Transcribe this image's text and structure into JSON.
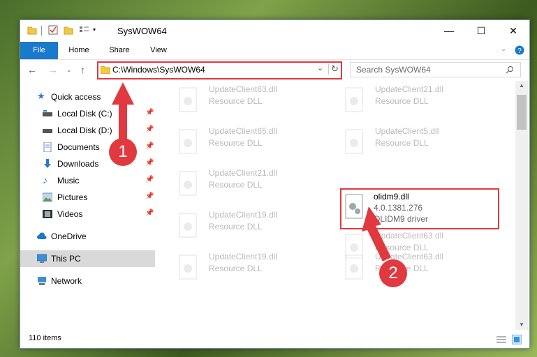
{
  "window": {
    "title": "SysWOW64"
  },
  "ribbon": {
    "tabs": [
      "File",
      "Home",
      "Share",
      "View"
    ]
  },
  "address": {
    "path": "C:\\Windows\\SysWOW64"
  },
  "search": {
    "placeholder": "Search SysWOW64"
  },
  "sidebar": {
    "items": [
      {
        "label": "Quick access"
      },
      {
        "label": "Local Disk (C:)"
      },
      {
        "label": "Local Disk (D:)"
      },
      {
        "label": "Documents"
      },
      {
        "label": "Downloads"
      },
      {
        "label": "Music"
      },
      {
        "label": "Pictures"
      },
      {
        "label": "Videos"
      },
      {
        "label": "OneDrive"
      },
      {
        "label": "This PC"
      },
      {
        "label": "Network"
      }
    ]
  },
  "files": [
    {
      "name": "UpdateClient63.dll",
      "desc": "Resource DLL"
    },
    {
      "name": "UpdateClient21.dll",
      "desc": "Resource DLL"
    },
    {
      "name": "UpdateClient65.dll",
      "desc": "Resource DLL"
    },
    {
      "name": "UpdateClient5.dll",
      "desc": "Resource DLL"
    },
    {
      "name": "UpdateClient21.dll",
      "desc": "Resource DLL"
    },
    {
      "name": "olidm9.dll",
      "version": "4.0.1381.276",
      "desc": "OLIDM9 driver"
    },
    {
      "name": "UpdateClient19.dll",
      "desc": "Resource DLL"
    },
    {
      "name": "UpdateClient63.dll",
      "desc": "Resource DLL"
    },
    {
      "name": "UpdateClient19.dll",
      "desc": "Resource DLL"
    },
    {
      "name": "UpdateClient63.dll",
      "desc": "Resource DLL"
    }
  ],
  "status": {
    "count": "110 items"
  },
  "annotations": {
    "step1": "1",
    "step2": "2"
  },
  "colors": {
    "highlight": "#e0393f",
    "accent": "#1979ca"
  }
}
